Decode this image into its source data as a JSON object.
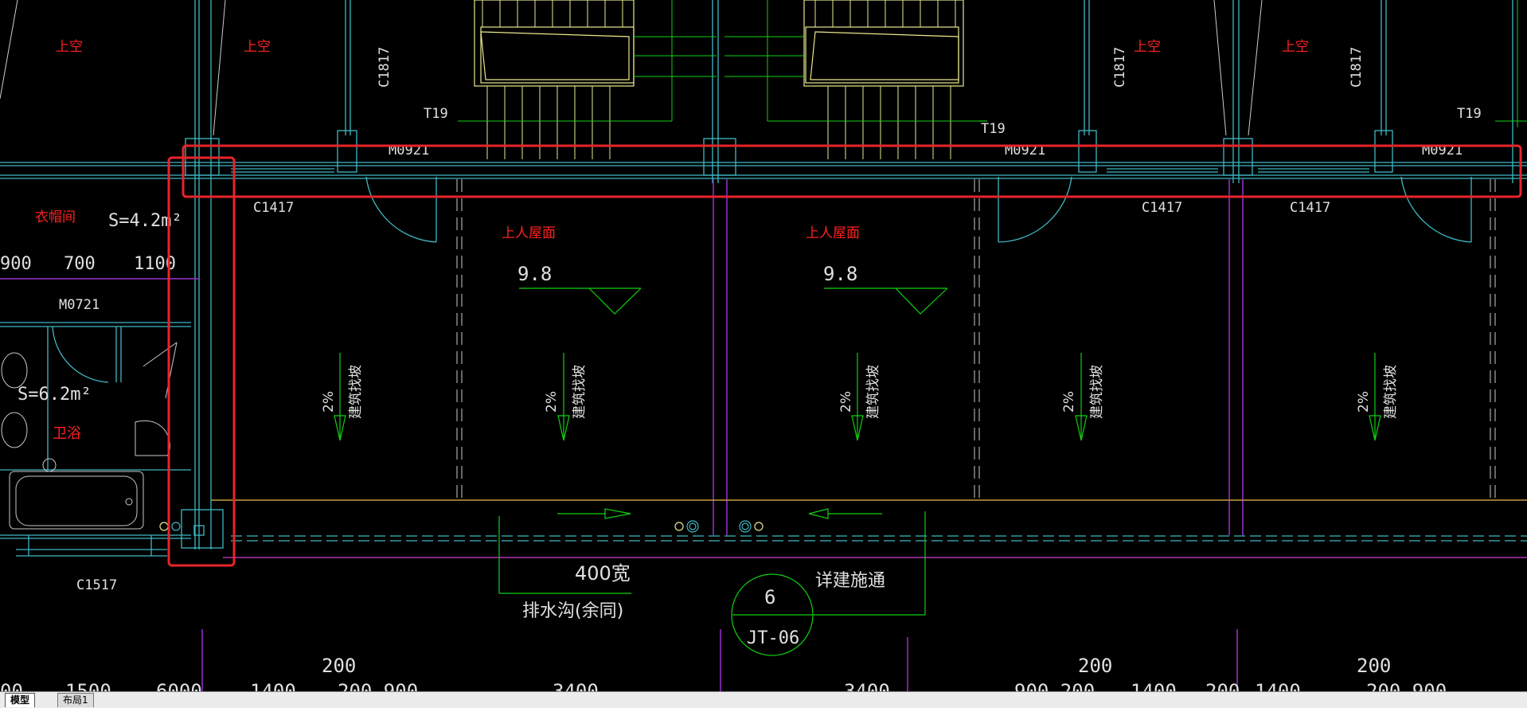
{
  "colors": {
    "background": "#000000",
    "cyan": "#3fb8c4",
    "wall": "#35c3c8",
    "red": "#ff2020",
    "highlight": "#e8242a",
    "green": "#10d010",
    "yellow": "#e8e890",
    "purple": "#9b30d0",
    "white": "#e0e0e0",
    "orange": "#c89a40",
    "magenta": "#d23ccf"
  },
  "labels": {
    "shangkong": "上空",
    "c1817": "C1817",
    "t19": "T19",
    "m0921": "M0921",
    "c1417": "C1417",
    "yimaojian": "衣帽间",
    "area_42": "S=4.2m²",
    "area_62": "S=6.2m²",
    "weiyu": "卫浴",
    "dim_900": "900",
    "dim_700": "700",
    "dim_1100": "1100",
    "m0721": "M0721",
    "shangren_wumian": "上人屋面",
    "elev": "9.8",
    "slope": "2%",
    "jianzhu_zhaopo": "建筑找坡",
    "c1517": "C1517",
    "width_400": "400宽",
    "paishuigou": "排水沟(余同)",
    "detail_num": "6",
    "detail_sheet": "JT-06",
    "detail_note": "详建施通",
    "dim_200": "200",
    "dim_1500": "1500",
    "dim_6000": "6000",
    "dim_1400": "1400",
    "dim_200900": "200 900",
    "dim_3400": "3400",
    "dim_900200": "900 200",
    "dim_1400_2": "1400",
    "dim_200_2": "200",
    "dim_00": "00"
  },
  "tabs": [
    {
      "label": "模型",
      "active": true
    },
    {
      "label": "布局1",
      "active": false
    }
  ]
}
